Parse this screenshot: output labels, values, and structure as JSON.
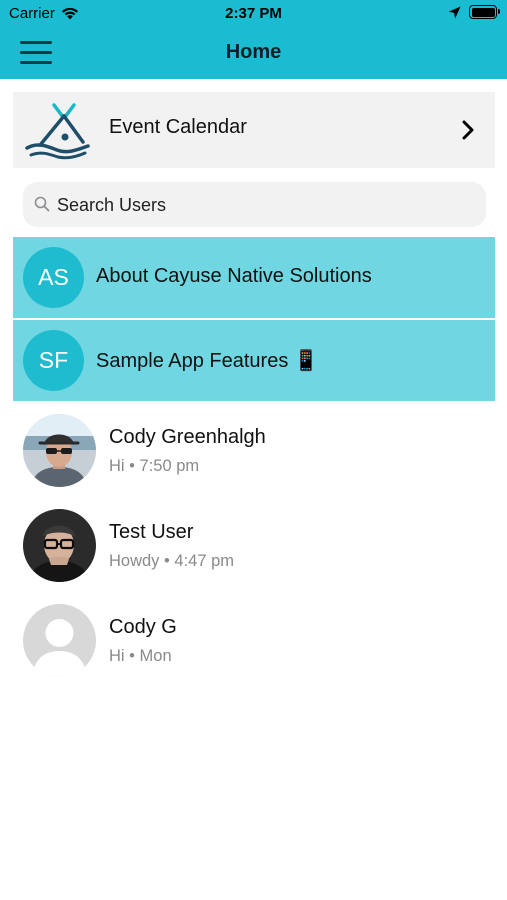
{
  "status_bar": {
    "carrier": "Carrier",
    "time": "2:37 PM"
  },
  "nav": {
    "title": "Home",
    "menu_icon": "hamburger-menu-icon"
  },
  "event_calendar": {
    "label": "Event Calendar",
    "logo_icon": "tipi-logo-icon",
    "chevron_icon": "chevron-right-icon"
  },
  "search": {
    "placeholder": "Search Users",
    "icon": "search-icon"
  },
  "channels": [
    {
      "initials": "AS",
      "label": "About Cayuse Native Solutions"
    },
    {
      "initials": "SF",
      "label": "Sample App Features 📱"
    }
  ],
  "users": [
    {
      "name": "Cody Greenhalgh",
      "message": "Hi",
      "time": "7:50 pm"
    },
    {
      "name": "Test User",
      "message": "Howdy",
      "time": "4:47 pm"
    },
    {
      "name": "Cody G",
      "message": "Hi",
      "time": "Mon"
    }
  ],
  "colors": {
    "header": "#19bcd0",
    "channel_row": "#6fd6e2",
    "channel_avatar": "#1fbccf",
    "logo": "#1e4e68"
  }
}
